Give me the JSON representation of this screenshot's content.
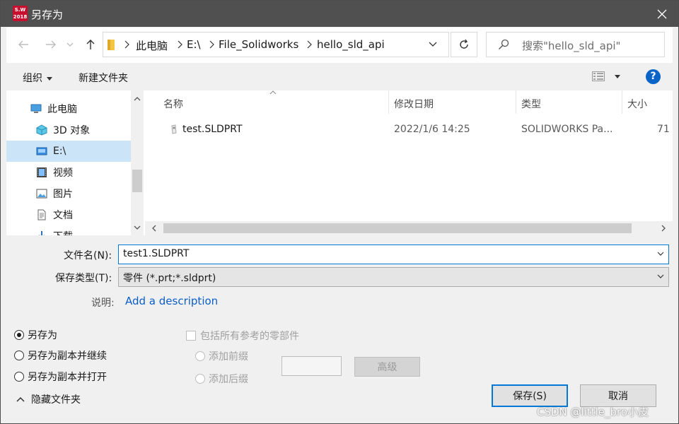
{
  "window": {
    "title": "另存为",
    "app_icon_text": [
      "S.W",
      "2018"
    ]
  },
  "nav": {
    "crumbs": [
      "此电脑",
      "E:\\",
      "File_Solidworks",
      "hello_sld_api"
    ],
    "search_placeholder": "搜索\"hello_sld_api\""
  },
  "toolbar": {
    "organize": "组织",
    "new_folder": "新建文件夹"
  },
  "tree": {
    "items": [
      {
        "label": "此电脑",
        "icon": "computer-icon"
      },
      {
        "label": "3D 对象",
        "icon": "3d-objects-icon"
      },
      {
        "label": "E:\\",
        "icon": "drive-icon"
      },
      {
        "label": "视频",
        "icon": "video-icon"
      },
      {
        "label": "图片",
        "icon": "pictures-icon"
      },
      {
        "label": "文档",
        "icon": "documents-icon"
      },
      {
        "label": "下载",
        "icon": "downloads-icon"
      }
    ]
  },
  "list": {
    "columns": [
      "名称",
      "修改日期",
      "类型",
      "大小"
    ],
    "rows": [
      {
        "name": "test.SLDPRT",
        "date": "2022/1/6 14:25",
        "type": "SOLIDWORKS Pa...",
        "size": "71"
      }
    ]
  },
  "form": {
    "filename_label": "文件名(N):",
    "filename_value": "test1.SLDPRT",
    "type_label": "保存类型(T):",
    "type_value": "零件 (*.prt;*.sldprt)",
    "desc_label": "说明:",
    "desc_link": "Add a description"
  },
  "options": {
    "save_as": "另存为",
    "save_copy_continue": "另存为副本并继续",
    "save_copy_open": "另存为副本并打开",
    "include_refs": "包括所有参考的零部件",
    "add_prefix": "添加前缀",
    "add_suffix": "添加后缀",
    "advanced": "高级"
  },
  "buttons": {
    "save": "保存(S)",
    "cancel": "取消",
    "hide_folders": "隐藏文件夹"
  },
  "watermark": "CSDN @little_bro小皮",
  "colors": {
    "titlebar": "#505050",
    "selection": "#cce4f7",
    "accent": "#0078d7",
    "link": "#0b5ec9"
  }
}
